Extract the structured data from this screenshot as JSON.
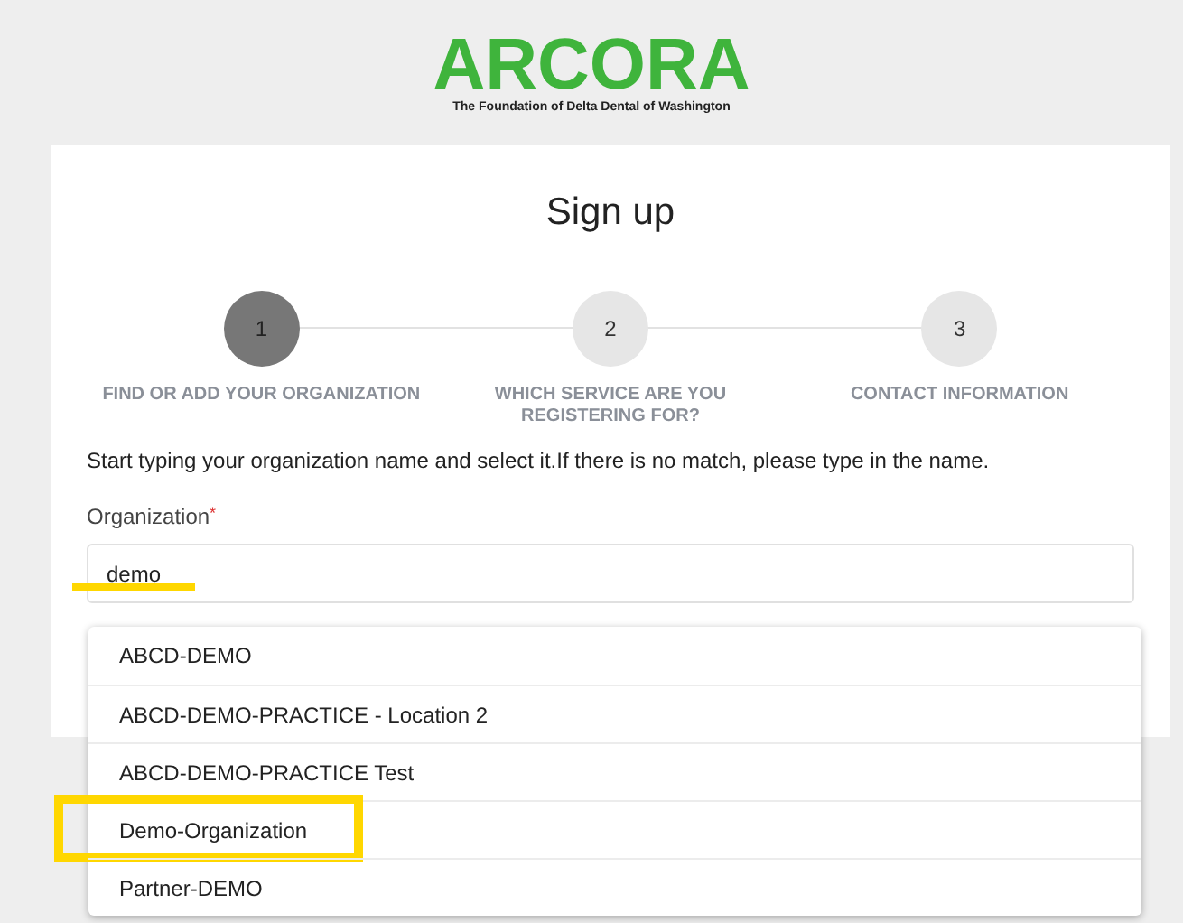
{
  "logo": {
    "name": "ARCORA",
    "tagline": "The Foundation of Delta Dental of Washington"
  },
  "title": "Sign up",
  "steps": [
    {
      "number": "1",
      "label": "FIND OR ADD YOUR ORGANIZATION",
      "selected": true
    },
    {
      "number": "2",
      "label": "WHICH SERVICE ARE YOU REGISTERING FOR?",
      "selected": false
    },
    {
      "number": "3",
      "label": "CONTACT INFORMATION",
      "selected": false
    }
  ],
  "instructions": "Start typing your organization name and select it.If there is no match, please type in the name.",
  "field": {
    "label": "Organization",
    "required_mark": "*",
    "value": "demo",
    "highlighted": true
  },
  "options": [
    {
      "label": "ABCD-DEMO",
      "highlighted": false
    },
    {
      "label": "ABCD-DEMO-PRACTICE - Location 2",
      "highlighted": false
    },
    {
      "label": "ABCD-DEMO-PRACTICE Test",
      "highlighted": false
    },
    {
      "label": "Demo-Organization",
      "highlighted": true
    },
    {
      "label": "Partner-DEMO",
      "highlighted": false
    }
  ]
}
